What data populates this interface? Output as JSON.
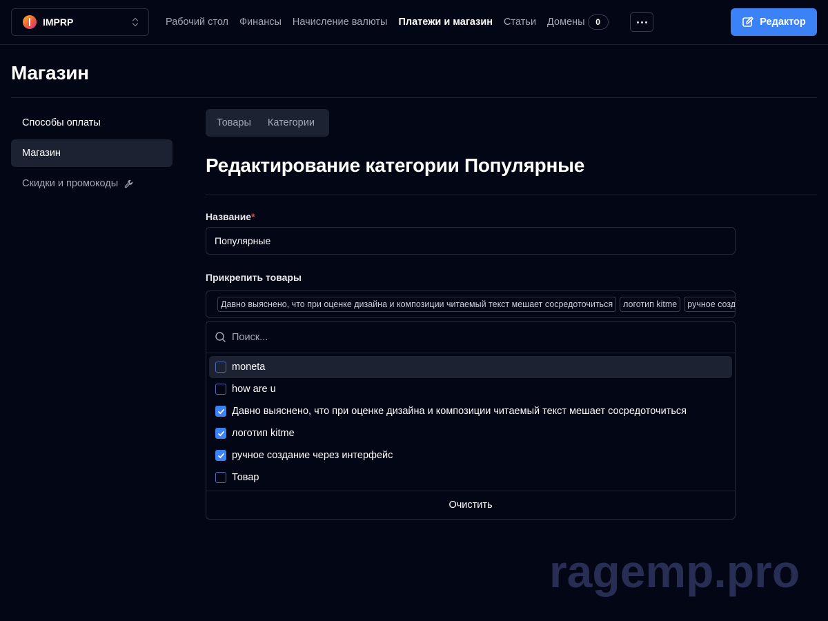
{
  "project": {
    "name": "IMPRP"
  },
  "nav": {
    "items": [
      "Рабочий стол",
      "Финансы",
      "Начисление валюты",
      "Платежи и магазин",
      "Статьи"
    ],
    "domains_label": "Домены",
    "domains_count": "0"
  },
  "editor_button": "Редактор",
  "page_title": "Магазин",
  "sidebar": {
    "items": [
      "Способы оплаты",
      "Магазин",
      "Скидки и промокоды"
    ]
  },
  "tabs": [
    "Товары",
    "Категории"
  ],
  "form": {
    "title": "Редактирование категории Популярные",
    "name_label": "Название",
    "required_mark": "*",
    "name_value": "Популярные",
    "attach_label": "Прикрепить товары",
    "selected_tags": [
      "Давно выяснено, что при оценке дизайна и композиции читаемый текст мешает сосредоточиться",
      "логотип kitme",
      "ручное создание через интерфейс"
    ]
  },
  "dropdown": {
    "search_placeholder": "Поиск...",
    "options": [
      {
        "label": "moneta",
        "checked": false
      },
      {
        "label": "how are u",
        "checked": false
      },
      {
        "label": "Давно выяснено, что при оценке дизайна и композиции читаемый текст мешает сосредоточиться",
        "checked": true
      },
      {
        "label": "логотип kitme",
        "checked": true
      },
      {
        "label": "ручное создание через интерфейс",
        "checked": true
      },
      {
        "label": "Товар",
        "checked": false
      }
    ],
    "clear_label": "Очистить"
  },
  "watermark": "ragemp.pro",
  "colors": {
    "background": "#030615",
    "accent": "#3b82f6",
    "active_bg": "#1c2232"
  }
}
